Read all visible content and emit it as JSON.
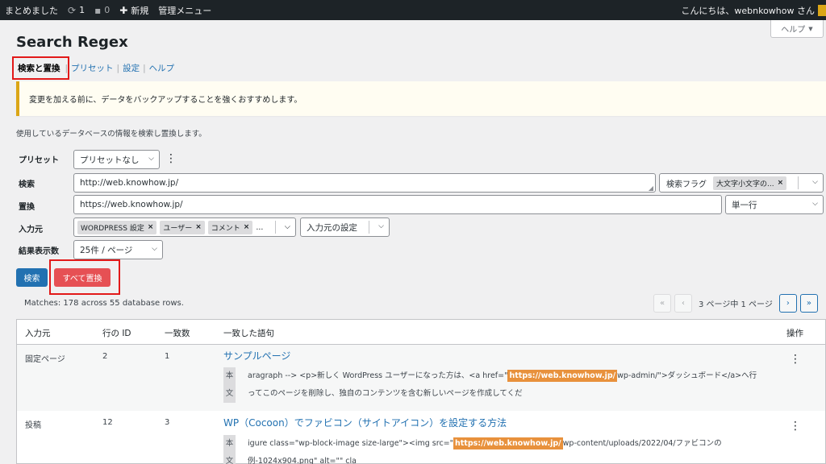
{
  "adminbar": {
    "site_name": "まとめました",
    "updates_count": "1",
    "comments_count": "0",
    "new_label": "新規",
    "manage_menu": "管理メニュー",
    "greeting": "こんにちは、webnkowhow さん"
  },
  "help_tab": {
    "label": "ヘルプ",
    "arrow": "▼"
  },
  "page": {
    "title": "Search Regex"
  },
  "subnav": {
    "current": "検索と置換",
    "items": [
      "プリセット",
      "設定",
      "ヘルプ"
    ],
    "sep": "|"
  },
  "notice": {
    "text": "変更を加える前に、データをバックアップすることを強くおすすめします。"
  },
  "description": "使用しているデータベースの情報を検索し置換します。",
  "form": {
    "preset_label": "プリセット",
    "preset_value": "プリセットなし",
    "search_label": "検索",
    "search_value": "http://web.knowhow.jp/",
    "search_flags_label": "検索フラグ",
    "search_flags_chip": "大文字小文字の...",
    "replace_label": "置換",
    "replace_value": "https://web.knowhow.jp/",
    "replace_mode": "単一行",
    "source_label": "入力元",
    "source_chips": [
      "WORDPRESS 設定",
      "ユーザー",
      "コメント"
    ],
    "source_more": "...",
    "source_settings": "入力元の設定",
    "results_label": "結果表示数",
    "results_value": "25件 / ページ"
  },
  "buttons": {
    "search": "検索",
    "replace_all": "すべて置換"
  },
  "matches_text": "Matches: 178 across 55 database rows.",
  "pager": {
    "first": "«",
    "prev": "‹",
    "info": "3 ページ中 1 ページ",
    "next": "›",
    "last": "»"
  },
  "table": {
    "headers": [
      "入力元",
      "行の ID",
      "一致数",
      "一致した語句",
      "操作"
    ],
    "rows": [
      {
        "source": "固定ページ",
        "row_id": "2",
        "matches": "1",
        "title": "サンプルページ",
        "ctx_label": [
          "本",
          "文"
        ],
        "line1_pre": "aragraph --> <p>新しく WordPress ユーザーになった方は、<a href=\"",
        "line1_mark": "https://web.knowhow.jp/",
        "line1_post": "wp-admin/\">ダッシュボード</a>へ行",
        "line2": "ってこのページを削除し、独自のコンテンツを含む新しいページを作成してくだ"
      },
      {
        "source": "投稿",
        "row_id": "12",
        "matches": "3",
        "title": "WP（Cocoon）でファビコン（サイトアイコン）を設定する方法",
        "ctx_label": [
          "本",
          "文"
        ],
        "line1_pre": "igure class=\"wp-block-image size-large\"><img src=\"",
        "line1_mark": "https://web.knowhow.jp/",
        "line1_post": "wp-content/uploads/2022/04/ファビコンの",
        "line2": "例-1024x904.png\" alt=\"\" cla"
      }
    ]
  }
}
